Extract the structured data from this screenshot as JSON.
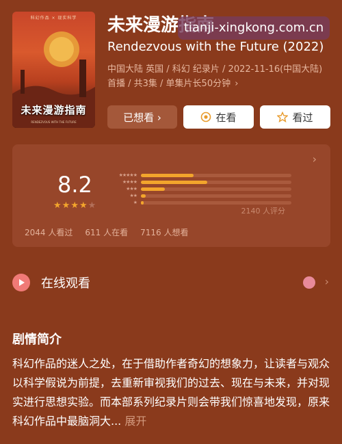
{
  "poster": {
    "top_text": "科幻作品 × 现实科学",
    "title": "未来漫游指南",
    "sub": "RENDEZVOUS WITH THE FUTURE"
  },
  "title_cn": "未来漫游指南",
  "watermark": "tianji-xingkong.com.cn",
  "title_en": "Rendezvous with the Future (2022)",
  "meta": {
    "line1": "中国大陆 英国 / 科幻 纪录片 / 2022-11-16(中国大陆)",
    "line2": "首播 / 共3集 / 单集片长50分钟"
  },
  "buttons": {
    "wanted": "已想看 ›",
    "watching": "在看",
    "watched": "看过"
  },
  "rating": {
    "score": "8.2",
    "stars_filled": 4,
    "stars_total": 5,
    "distribution": [
      {
        "stars": "★★★★★",
        "fraction": 0.35
      },
      {
        "stars": "★★★★",
        "fraction": 0.44
      },
      {
        "stars": "★★★",
        "fraction": 0.16
      },
      {
        "stars": "★★",
        "fraction": 0.03
      },
      {
        "stars": "★",
        "fraction": 0.02
      }
    ],
    "raters": "2140 人评分",
    "stats": {
      "watched": "2044 人看过",
      "watching": "611 人在看",
      "want": "7116 人想看"
    }
  },
  "online": {
    "label": "在线观看"
  },
  "synopsis": {
    "title": "剧情简介",
    "text": "科幻作品的迷人之处，在于借助作者奇幻的想象力，让读者与观众以科学假说为前提，去重新审视我们的过去、现在与未来，并对现实进行思想实验。而本部系列纪录片则会带我们惊喜地发现，原来科幻作品中最脑洞大...",
    "expand": "展开"
  },
  "colors": {
    "background": "#8a3a1c",
    "card": "#97462a",
    "accent_star": "#f3a52c",
    "play": "#f07a77"
  }
}
